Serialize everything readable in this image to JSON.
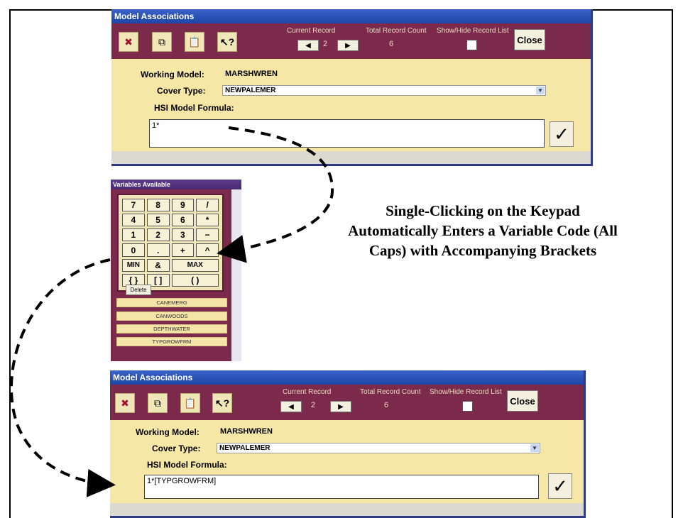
{
  "window_top": {
    "title": "Model Associations",
    "toolbar": {
      "current_record_label": "Current Record",
      "current_record_value": "2",
      "total_record_label": "Total Record Count",
      "total_record_value": "6",
      "show_hide_label": "Show/Hide Record List",
      "close_label": "Close"
    },
    "working_model_label": "Working Model:",
    "working_model_value": "MARSHWREN",
    "cover_type_label": "Cover Type:",
    "cover_type_value": "NEWPALEMER",
    "formula_label": "HSI Model Formula:",
    "formula_value": "1*"
  },
  "variables_panel": {
    "title": "Variables Available",
    "keypad": [
      "7",
      "8",
      "9",
      "/",
      "4",
      "5",
      "6",
      "*",
      "1",
      "2",
      "3",
      "−",
      "0",
      ".",
      "+",
      "^",
      "MIN",
      "&",
      "MAX",
      "{ }",
      "[ ]",
      "( )"
    ],
    "delete_label": "Delete",
    "items": [
      "CANEMERG",
      "CANWOODS",
      "DEPTHWATER",
      "TYPGROWFRM"
    ]
  },
  "annotation": "Single-Clicking on the Keypad Automatically Enters a Variable Code (All Caps) with Accompanying Brackets",
  "window_bottom": {
    "title": "Model Associations",
    "toolbar": {
      "current_record_label": "Current Record",
      "current_record_value": "2",
      "total_record_label": "Total Record Count",
      "total_record_value": "6",
      "show_hide_label": "Show/Hide Record List",
      "close_label": "Close"
    },
    "working_model_label": "Working Model:",
    "working_model_value": "MARSHWREN",
    "cover_type_label": "Cover Type:",
    "cover_type_value": "NEWPALEMER",
    "formula_label": "HSI Model Formula:",
    "formula_value": "1*[TYPGROWFRM]"
  },
  "colors": {
    "toolbar": "#7b2a4c",
    "form_background": "#f6e7a6",
    "title_bar": "#1d46a8"
  }
}
